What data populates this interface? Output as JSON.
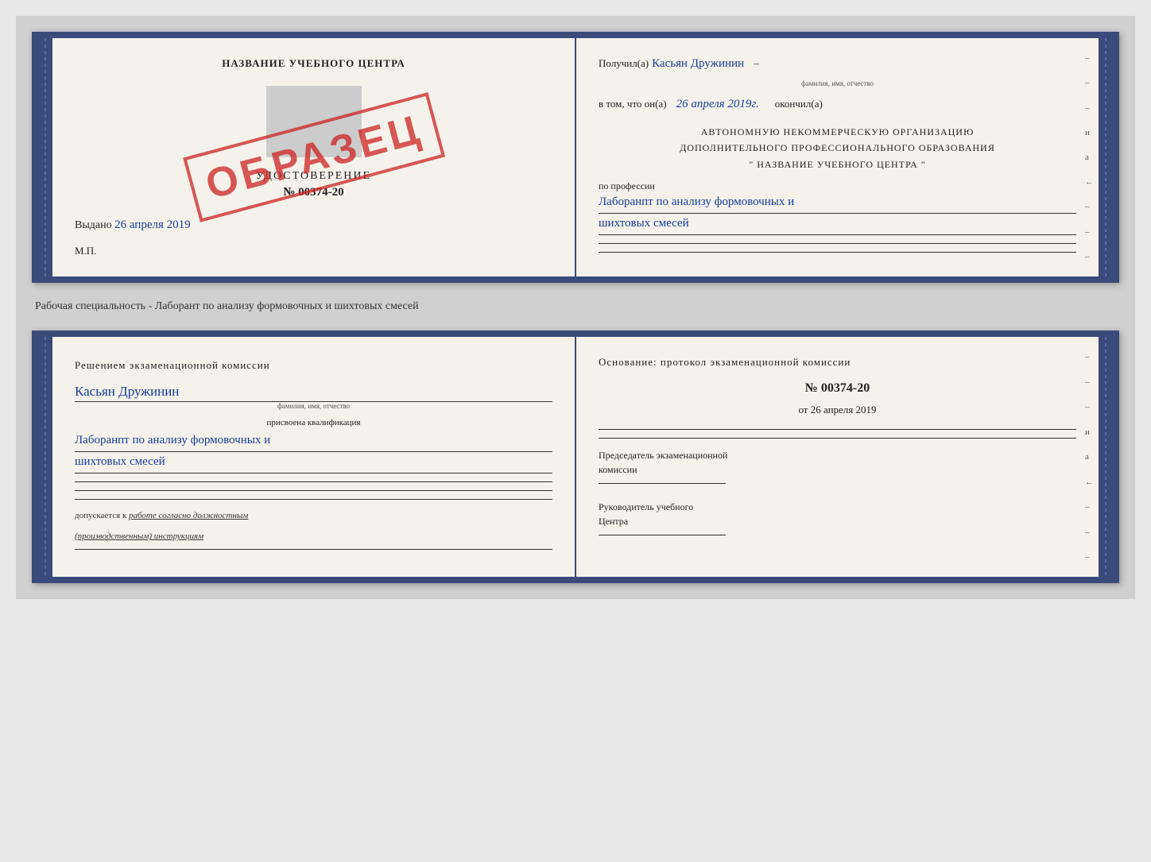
{
  "top_doc": {
    "left": {
      "title": "НАЗВАНИЕ УЧЕБНОГО ЦЕНТРА",
      "stamp": "ОБРАЗЕЦ",
      "udostoverenie_label": "УДОСТОВЕРЕНИЕ",
      "number": "№ 00374-20",
      "vydano_label": "Выдано",
      "vydano_date": "26 апреля 2019",
      "mp": "М.П."
    },
    "right": {
      "poluchil": "Получил(а)",
      "fio_handwritten": "Касьян Дружинин",
      "fio_sublabel": "фамилия, имя, отчество",
      "vtom_prefix": "в том, что он(а)",
      "date_handwritten": "26 апреля 2019г.",
      "okonchil": "окончил(а)",
      "block_line1": "АВТОНОМНУЮ НЕКОММЕРЧЕСКУЮ ОРГАНИЗАЦИЮ",
      "block_line2": "ДОПОЛНИТЕЛЬНОГО ПРОФЕССИОНАЛЬНОГО ОБРАЗОВАНИЯ",
      "block_line3": "\"   НАЗВАНИЕ УЧЕБНОГО ЦЕНТРА   \"",
      "po_professii": "по профессии",
      "profession_handwritten1": "Лаборанпт по анализу формовочных и",
      "profession_handwritten2": "шихтовых смесей",
      "side_marks": [
        "–",
        "–",
        "–",
        "и",
        "а",
        "←",
        "–",
        "–",
        "–"
      ]
    }
  },
  "separator": {
    "text": "Рабочая специальность - Лаборант по анализу формовочных и шихтовых смесей"
  },
  "bottom_doc": {
    "left": {
      "title_line1": "Решением  экзаменационной  комиссии",
      "fio_handwritten": "Касьян Дружинин",
      "fio_sublabel": "фамилия, имя, отчество",
      "kvalif_label": "присвоена квалификация",
      "profession_handwritten1": "Лаборанпт по анализу формовочных и",
      "profession_handwritten2": "шихтовых смесей",
      "dopusk_prefix": "допускается к",
      "dopusk_italic": "работе согласно должностным",
      "dopusk_italic2": "(производственным) инструкциям"
    },
    "right": {
      "osnov": "Основание: протокол экзаменационной  комиссии",
      "number": "№  00374-20",
      "ot_prefix": "от",
      "ot_date": "26 апреля 2019",
      "chairman_label1": "Председатель экзаменационной",
      "chairman_label2": "комиссии",
      "rukovoditel_label1": "Руководитель учебного",
      "rukovoditel_label2": "Центра",
      "side_marks": [
        "–",
        "–",
        "–",
        "и",
        "а",
        "←",
        "–",
        "–",
        "–"
      ]
    }
  }
}
